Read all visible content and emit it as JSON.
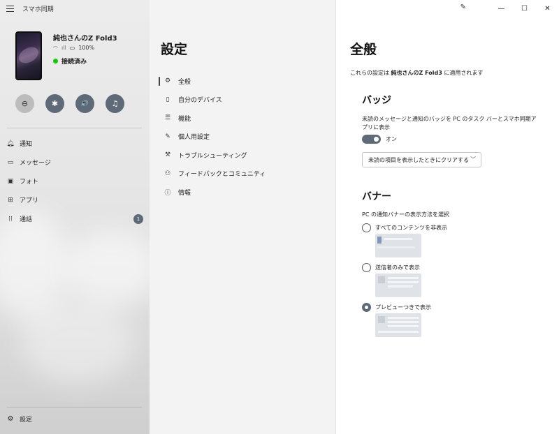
{
  "app": {
    "title": "スマホ同期",
    "phone_name": "純也さんのZ Fold3",
    "battery": "100%",
    "connection_status": "接続済み"
  },
  "quick_actions": [
    {
      "icon": "do-not-disturb-icon",
      "glyph": "⊖"
    },
    {
      "icon": "bluetooth-icon",
      "glyph": "✱"
    },
    {
      "icon": "volume-icon",
      "glyph": "🔊"
    },
    {
      "icon": "music-icon",
      "glyph": "♫"
    }
  ],
  "nav": {
    "items": [
      {
        "label": "通知",
        "icon": "bell-icon"
      },
      {
        "label": "メッセージ",
        "icon": "message-icon"
      },
      {
        "label": "フォト",
        "icon": "photo-icon"
      },
      {
        "label": "アプリ",
        "icon": "apps-icon"
      },
      {
        "label": "通話",
        "icon": "dialpad-icon",
        "badge": "1"
      }
    ],
    "settings_label": "設定"
  },
  "settings_menu": {
    "title": "設定",
    "items": [
      {
        "label": "全般",
        "icon": "gear-icon",
        "active": true
      },
      {
        "label": "自分のデバイス",
        "icon": "phone-icon"
      },
      {
        "label": "機能",
        "icon": "list-icon"
      },
      {
        "label": "個人用設定",
        "icon": "personalize-icon"
      },
      {
        "label": "トラブルシューティング",
        "icon": "wrench-icon"
      },
      {
        "label": "フィードバックとコミュニティ",
        "icon": "people-icon"
      },
      {
        "label": "情報",
        "icon": "info-icon"
      }
    ]
  },
  "general": {
    "title": "全般",
    "subtitle_pre": "これらの設定は ",
    "subtitle_device": "純也さんのZ Fold3",
    "subtitle_post": " に適用されます",
    "badge_section": {
      "title": "バッジ",
      "description": "未読のメッセージと通知のバッジを PC のタスク バーとスマホ同期アプリに表示",
      "toggle_label": "オン",
      "toggle_on": true,
      "dropdown_value": "未読の項目を表示したときにクリアする"
    },
    "banner_section": {
      "title": "バナー",
      "description": "PC の通知バナーの表示方法を選択",
      "options": [
        {
          "label": "すべてのコンテンツを非表示",
          "checked": false
        },
        {
          "label": "送信者のみで表示",
          "checked": false
        },
        {
          "label": "プレビューつきで表示",
          "checked": true
        }
      ]
    }
  },
  "colors": {
    "accent": "#5e6a78",
    "connected": "#16c60c"
  }
}
